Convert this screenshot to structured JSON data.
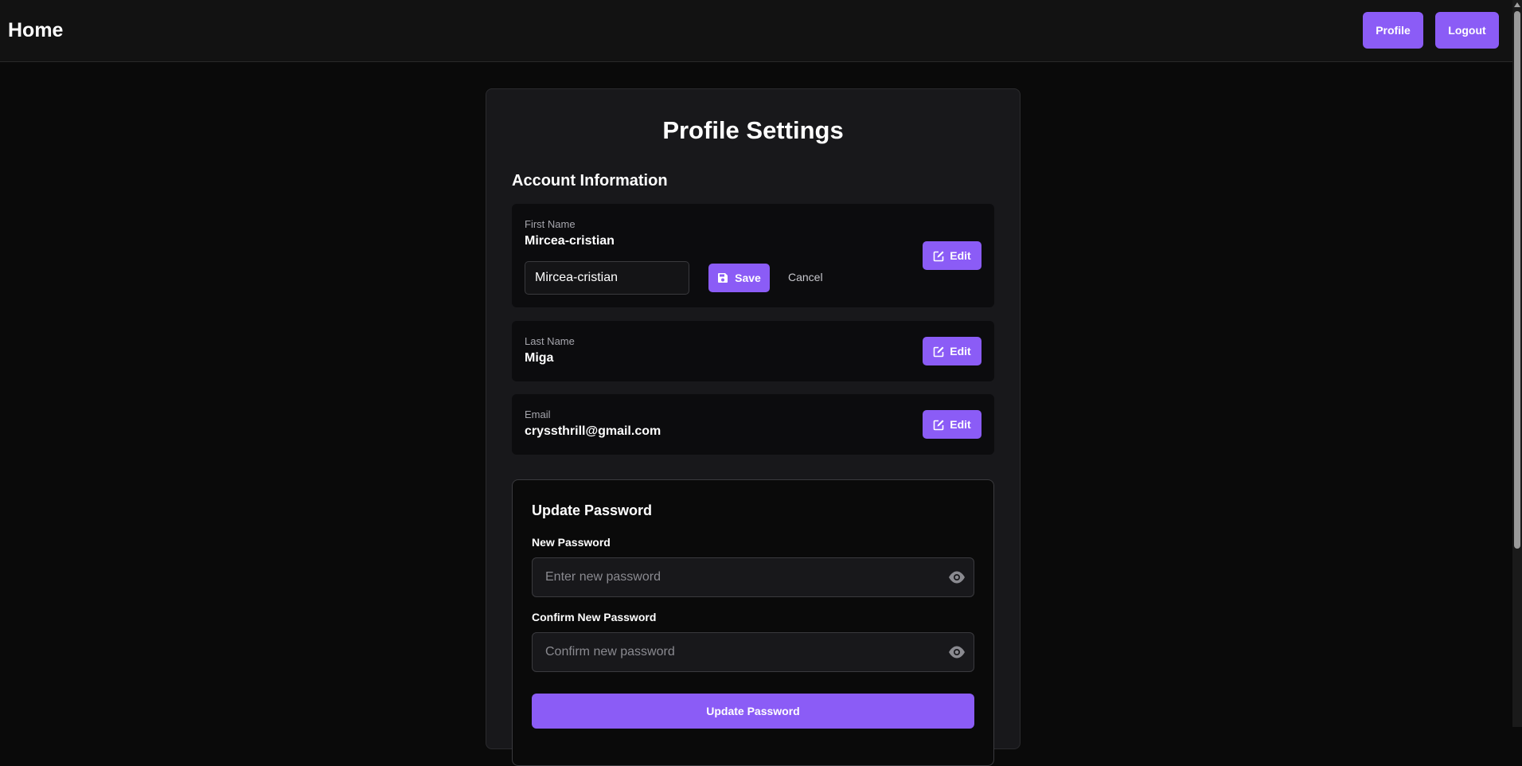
{
  "nav": {
    "home_label": "Home",
    "profile_label": "Profile",
    "logout_label": "Logout"
  },
  "colors": {
    "accent": "#8b5cf6",
    "background": "#0a0a0a",
    "card": "#18181b"
  },
  "settings": {
    "title": "Profile Settings",
    "account_section_title": "Account Information",
    "fields": [
      {
        "label": "First Name",
        "value": "Mircea-cristian",
        "editing": true,
        "input_value": "Mircea-cristian",
        "save_label": "Save",
        "cancel_label": "Cancel",
        "edit_label": "Edit"
      },
      {
        "label": "Last Name",
        "value": "Miga",
        "edit_label": "Edit"
      },
      {
        "label": "Email",
        "value": "cryssthrill@gmail.com",
        "edit_label": "Edit"
      }
    ]
  },
  "password": {
    "title": "Update Password",
    "new_label": "New Password",
    "new_placeholder": "Enter new password",
    "confirm_label": "Confirm New Password",
    "confirm_placeholder": "Confirm new password",
    "submit_label": "Update Password"
  },
  "icons": {
    "edit": "edit-icon",
    "save": "save-icon",
    "eye": "eye-icon"
  }
}
